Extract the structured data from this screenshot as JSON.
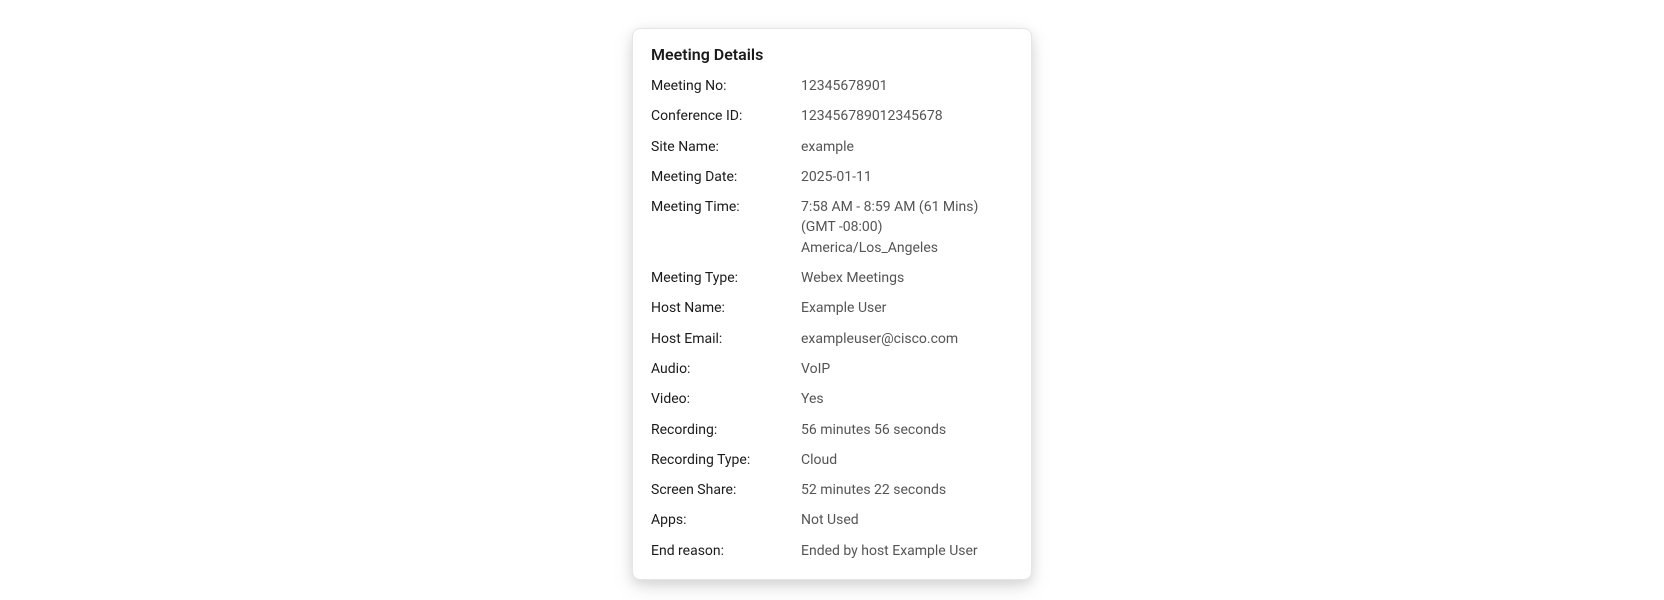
{
  "card": {
    "title": "Meeting Details",
    "rows": [
      {
        "label": "Meeting No:",
        "value": "12345678901"
      },
      {
        "label": "Conference ID:",
        "value": "123456789012345678"
      },
      {
        "label": "Site Name:",
        "value": "example"
      },
      {
        "label": "Meeting Date:",
        "value": "2025-01-11"
      },
      {
        "label": "Meeting Time:",
        "value": "7:58 AM - 8:59 AM (61 Mins) (GMT -08:00) America/Los_Angeles"
      },
      {
        "label": "Meeting Type:",
        "value": "Webex Meetings"
      },
      {
        "label": "Host Name:",
        "value": "Example User"
      },
      {
        "label": "Host Email:",
        "value": "exampleuser@cisco.com"
      },
      {
        "label": "Audio:",
        "value": "VoIP"
      },
      {
        "label": "Video:",
        "value": "Yes"
      },
      {
        "label": "Recording:",
        "value": "56 minutes 56 seconds"
      },
      {
        "label": "Recording Type:",
        "value": "Cloud"
      },
      {
        "label": "Screen Share:",
        "value": "52 minutes 22 seconds"
      },
      {
        "label": "Apps:",
        "value": "Not Used"
      },
      {
        "label": "End reason:",
        "value": "Ended by host Example User"
      }
    ]
  }
}
